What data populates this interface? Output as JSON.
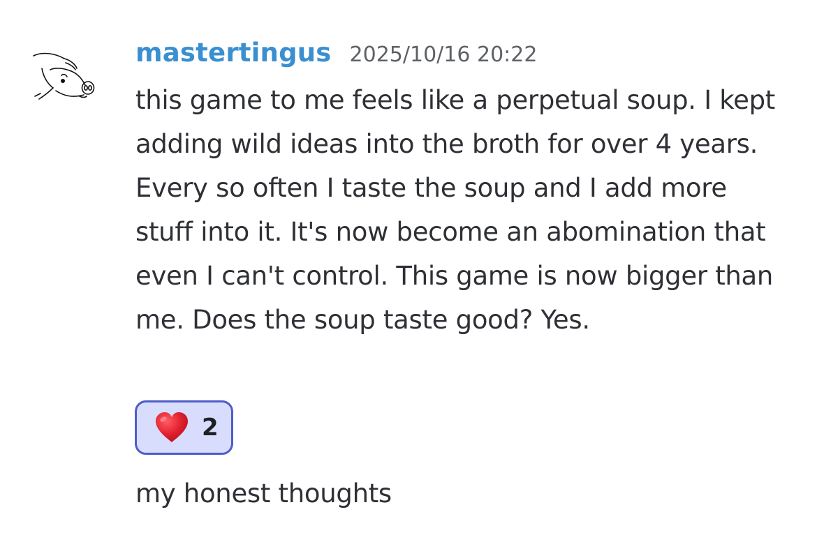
{
  "message": {
    "username": "mastertingus",
    "timestamp": "2025/10/16 20:22",
    "text": "this game to me feels like a perpetual soup. I kept adding wild ideas into the broth for over 4 years. Every so often I taste the soup and I add more stuff into it. It's now become an abomination that even I can't control. This game is now bigger than me. Does the soup taste good? Yes.",
    "avatar_icon": "pig-sketch-icon"
  },
  "reaction": {
    "emoji_icon": "red-heart-icon",
    "count": "2",
    "bg_color": "#d8ddfd",
    "border_color": "#4f5bc7"
  },
  "followup_message": {
    "text": "my honest thoughts"
  },
  "colors": {
    "username": "#3a8fd0",
    "timestamp": "#5e6167",
    "text": "#2e3035",
    "heart": "#e0202e"
  }
}
